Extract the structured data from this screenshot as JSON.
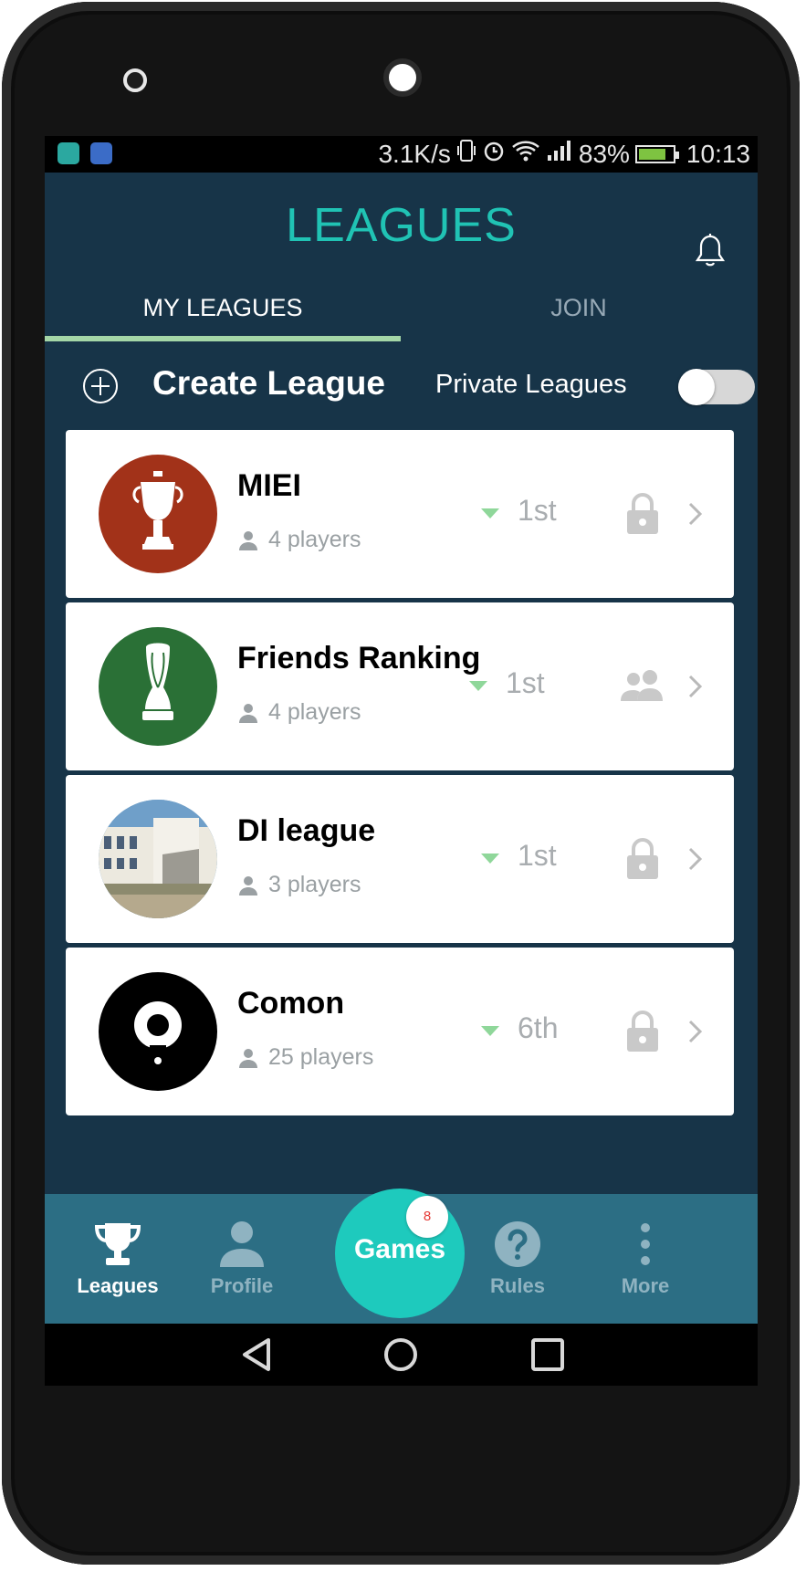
{
  "status_bar": {
    "net_speed": "3.1K/s",
    "battery_percent": "83%",
    "battery_level": 0.83,
    "time": "10:13"
  },
  "header": {
    "title": "LEAGUES"
  },
  "tabs": {
    "my_leagues": "MY LEAGUES",
    "join": "JOIN"
  },
  "create_row": {
    "create_label": "Create League",
    "private_label": "Private Leagues",
    "private_toggle_on": false
  },
  "leagues": [
    {
      "name": "MIEI",
      "players": "4 players",
      "rank": "1st",
      "privacy_icon": "lock-icon",
      "avatar_color": "#a23219"
    },
    {
      "name": "Friends Ranking",
      "players": "4 players",
      "rank": "1st",
      "privacy_icon": "group-icon",
      "avatar_color": "#2a7036"
    },
    {
      "name": "DI league",
      "players": "3 players",
      "rank": "1st",
      "privacy_icon": "lock-icon",
      "avatar_color": "#7aa6c8"
    },
    {
      "name": "Comon",
      "players": "25 players",
      "rank": "6th",
      "privacy_icon": "lock-icon",
      "avatar_color": "#000000"
    }
  ],
  "bottom_nav": {
    "leagues": "Leagues",
    "profile": "Profile",
    "games": "Games",
    "games_badge": "8",
    "rules": "Rules",
    "more": "More"
  },
  "colors": {
    "background": "#173448",
    "accent": "#20c3b4",
    "tab_indicator": "#a4d6a7",
    "nav_bar": "#2c6e84",
    "fab": "#1ecabd"
  }
}
